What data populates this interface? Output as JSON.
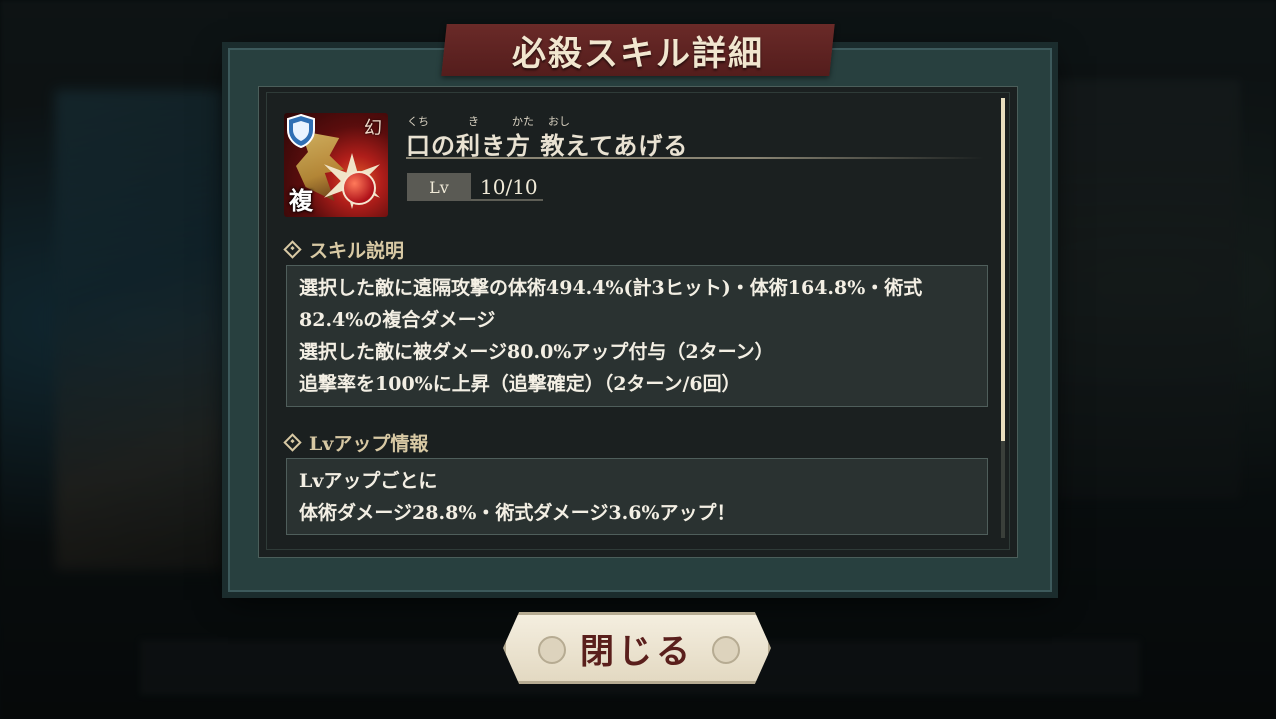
{
  "dialog": {
    "title": "必殺スキル詳細",
    "close_label": "閉じる"
  },
  "skill": {
    "name": "口の利き方 教えてあげる",
    "furigana": {
      "kuchi": "くち",
      "ki": "き",
      "kata": "かた",
      "oshi": "おし"
    },
    "icon_badge": "複",
    "icon_corner": "幻",
    "level_label": "Lv",
    "level_value": "10/10"
  },
  "sections": {
    "description": {
      "header": "スキル説明",
      "lines": [
        "選択した敵に遠隔攻撃の体術494.4%(計3ヒット)・体術164.8%・術式",
        "82.4%の複合ダメージ",
        "選択した敵に被ダメージ80.0%アップ付与（2ターン）",
        "追撃率を100%に上昇（追撃確定）（2ターン/6回）"
      ]
    },
    "levelup": {
      "header": "Lvアップ情報",
      "lines": [
        "Lvアップごとに",
        "体術ダメージ28.8%・術式ダメージ3.6%アップ！"
      ]
    }
  },
  "icons": {
    "section_marker": "diamond-icon",
    "skill_type": "shield-icon"
  },
  "colors": {
    "title_ribbon": "#6a2a28",
    "panel_bg": "#1b2020",
    "text": "#f3efe4",
    "section_header": "#d8c9a4",
    "close_text": "#5a1f1c"
  },
  "scroll": {
    "visible_fraction": 0.78
  }
}
